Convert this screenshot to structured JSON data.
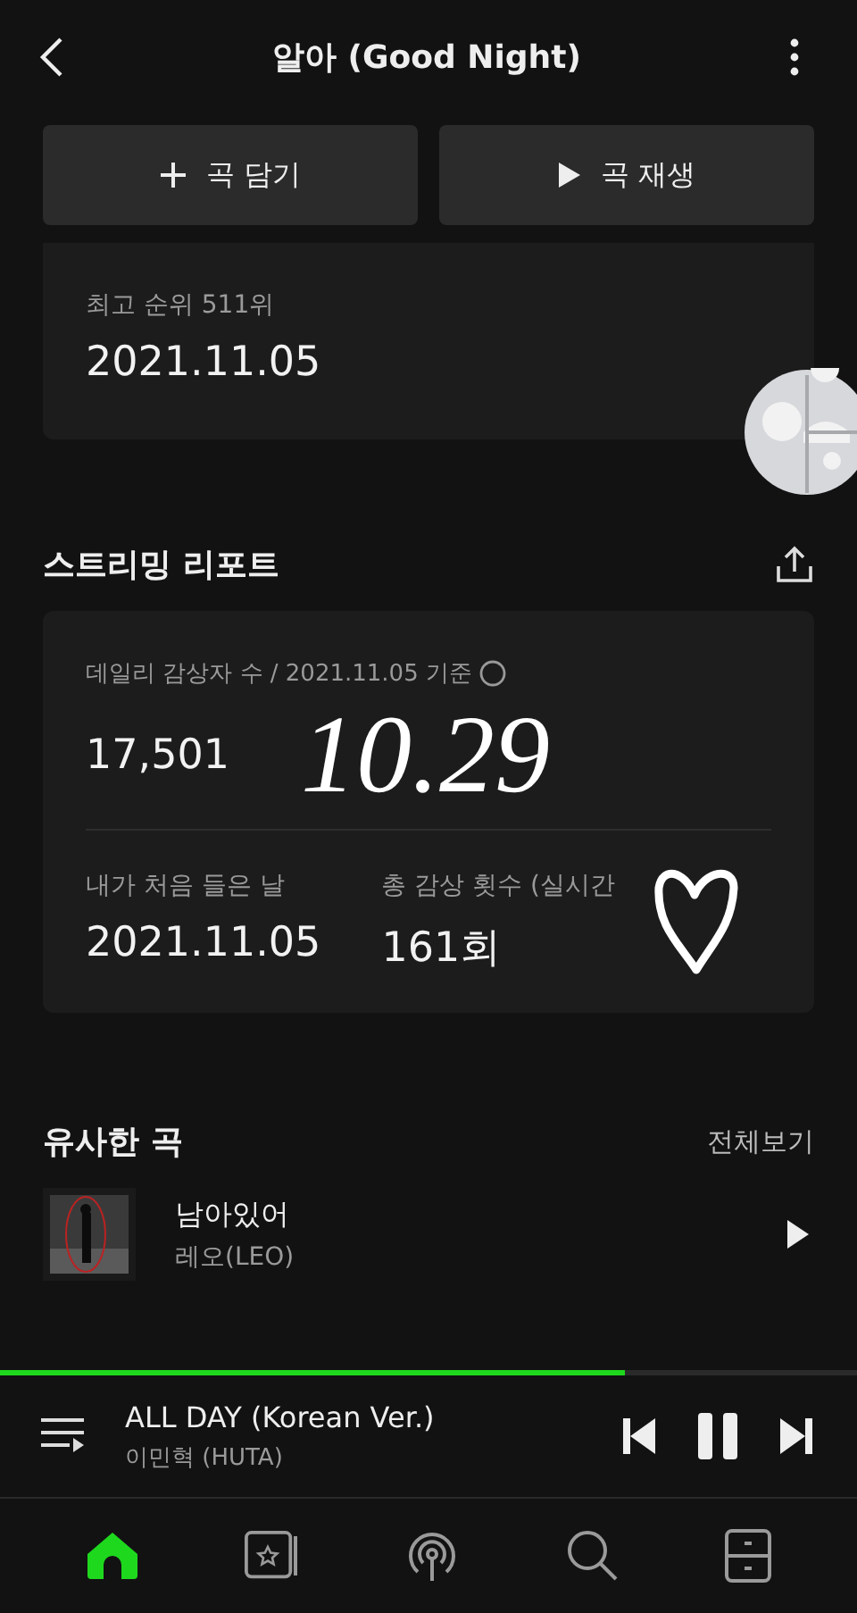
{
  "header": {
    "title": "알아 (Good Night)"
  },
  "actions": [
    {
      "label": "곡 담기",
      "kind": "add"
    },
    {
      "label": "곡 재생",
      "kind": "play"
    }
  ],
  "peak_card": {
    "label": "최고 순위 511위",
    "date": "2021.11.05"
  },
  "report": {
    "title": "스트리밍 리포트",
    "daily_label": "데일리 감상자 수 / 2021.11.05 기준",
    "daily_value": "17,501",
    "first_label": "내가 처음 들은 날",
    "first_value": "2021.11.05",
    "total_label": "총 감상 횟수 (실시간",
    "total_value": "161회"
  },
  "annotation": {
    "text": "10.29"
  },
  "similar": {
    "title": "유사한 곡",
    "more": "전체보기",
    "songs": [
      {
        "title": "남아있어",
        "artist": "레오(LEO)"
      }
    ]
  },
  "player": {
    "title": "ALL DAY (Korean Ver.)",
    "artist": "이민혁 (HUTA)",
    "level": 0.73,
    "playing": true
  },
  "nav": [
    {
      "kind": "home",
      "selected": true
    },
    {
      "kind": "library",
      "selected": false
    },
    {
      "kind": "podcast",
      "selected": false
    },
    {
      "kind": "search",
      "selected": false
    },
    {
      "kind": "storage",
      "selected": false
    }
  ]
}
